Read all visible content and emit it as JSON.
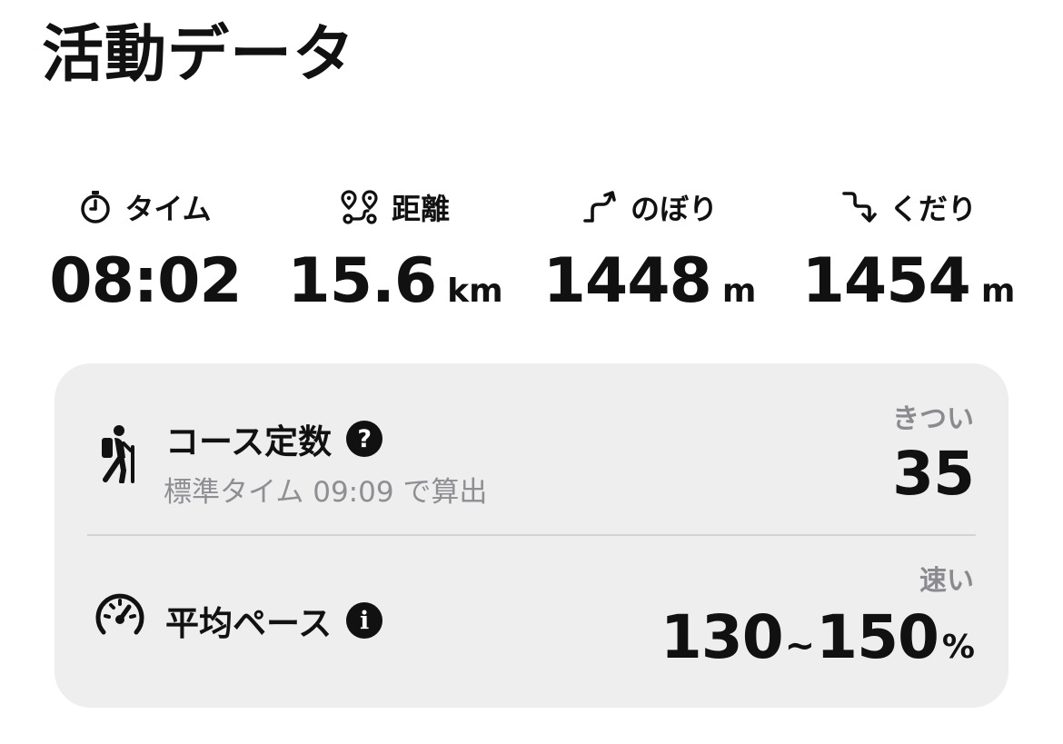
{
  "header": {
    "title": "活動データ"
  },
  "stats": [
    {
      "label": "タイム",
      "value": "08:02",
      "unit": "",
      "icon": "stopwatch-icon"
    },
    {
      "label": "距離",
      "value": "15.6",
      "unit": "km",
      "icon": "route-pins-icon"
    },
    {
      "label": "のぼり",
      "value": "1448",
      "unit": "m",
      "icon": "ascent-arrow-icon"
    },
    {
      "label": "くだり",
      "value": "1454",
      "unit": "m",
      "icon": "descent-arrow-icon"
    }
  ],
  "course": {
    "title": "コース定数",
    "help_icon": "?",
    "subtitle": "標準タイム 09:09 で算出",
    "rating": "きつい",
    "value": "35",
    "icon": "hiker-icon"
  },
  "pace": {
    "title": "平均ペース",
    "info_icon": "i",
    "rating": "速い",
    "value_low": "130",
    "tilde": "~",
    "value_high": "150",
    "unit": "%",
    "icon": "speedometer-icon"
  },
  "colors": {
    "text": "#111111",
    "card_bg": "#eeeeee",
    "muted": "#8e8e93",
    "divider": "#d3d3d3"
  }
}
